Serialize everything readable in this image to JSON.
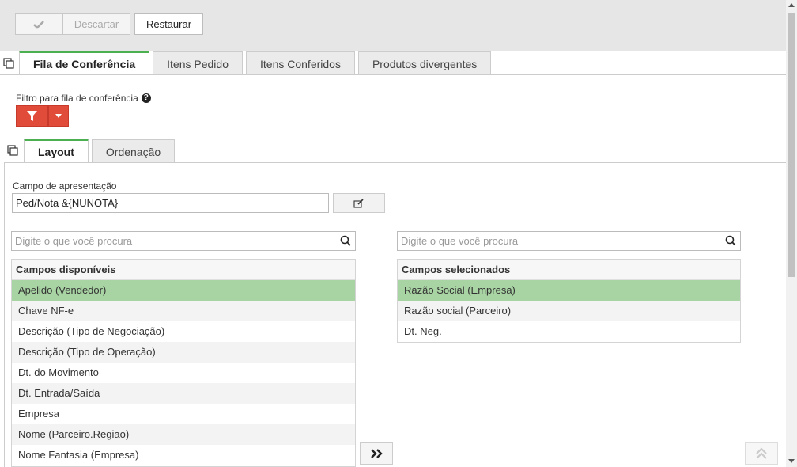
{
  "toolbar": {
    "discard_label": "Descartar",
    "restore_label": "Restaurar"
  },
  "main_tabs": [
    {
      "label": "Fila de Conferência",
      "active": true
    },
    {
      "label": "Itens Pedido",
      "active": false
    },
    {
      "label": "Itens Conferidos",
      "active": false
    },
    {
      "label": "Produtos divergentes",
      "active": false
    }
  ],
  "filter": {
    "label": "Filtro para fila de conferência"
  },
  "sub_tabs": [
    {
      "label": "Layout",
      "active": true
    },
    {
      "label": "Ordenação",
      "active": false
    }
  ],
  "presentation_field": {
    "label": "Campo de apresentação",
    "value": "Ped/Nota &{NUNOTA}"
  },
  "available": {
    "search_placeholder": "Digite o que você procura",
    "header": "Campos disponíveis",
    "items": [
      "Apelido (Vendedor)",
      "Chave NF-e",
      "Descrição (Tipo de Negociação)",
      "Descrição (Tipo de Operação)",
      "Dt. do Movimento",
      "Dt. Entrada/Saída",
      "Empresa",
      "Nome (Parceiro.Regiao)",
      "Nome Fantasia (Empresa)"
    ]
  },
  "selected": {
    "search_placeholder": "Digite o que você procura",
    "header": "Campos selecionados",
    "items": [
      "Razão Social (Empresa)",
      "Razão social (Parceiro)",
      "Dt. Neg."
    ]
  },
  "colors": {
    "accent_green": "#4caf50",
    "selected_row": "#a8d3a3",
    "filter_red": "#e04b3a"
  }
}
